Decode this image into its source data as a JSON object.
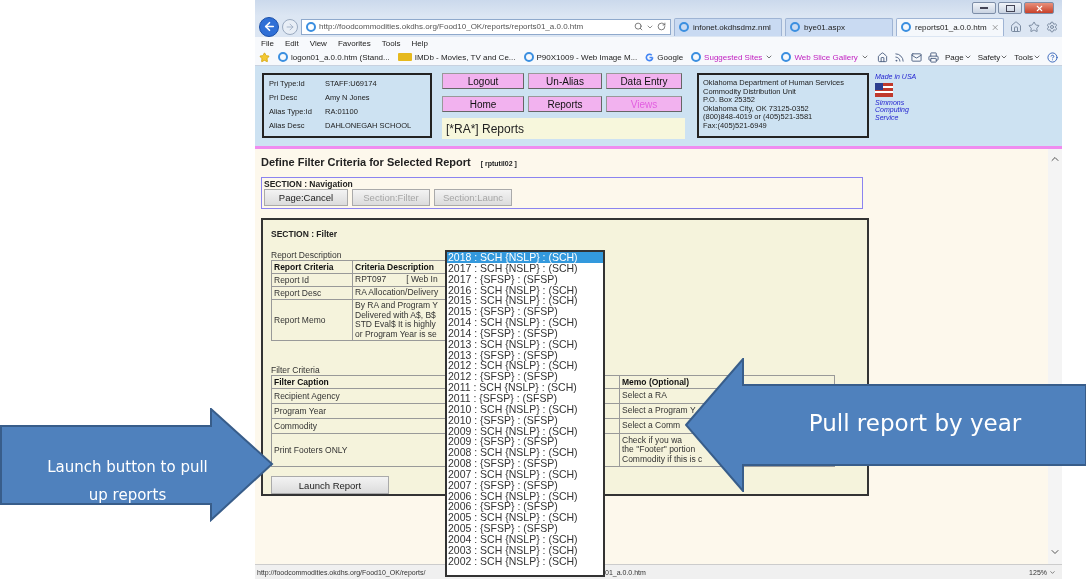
{
  "browser": {
    "address": "http://foodcommodities.okdhs.org/Food10_OK/reports/reports01_a.0.0.htm",
    "tabs": [
      {
        "label": "infonet.okdhsdmz.nml",
        "selected": false
      },
      {
        "label": "bye01.aspx",
        "selected": false
      },
      {
        "label": "reports01_a.0.0.htm",
        "selected": true
      }
    ],
    "menu": [
      "File",
      "Edit",
      "View",
      "Favorites",
      "Tools",
      "Help"
    ],
    "favorites": [
      {
        "label": "logon01_a.0.0.htm (Stand...",
        "kind": "page"
      },
      {
        "label": "IMDb - Movies, TV and Ce...",
        "kind": "imdb"
      },
      {
        "label": "P90X1009 - Web Image M...",
        "kind": "page"
      },
      {
        "label": "Google",
        "kind": "google"
      },
      {
        "label": "Suggested Sites",
        "kind": "menu"
      },
      {
        "label": "Web Slice Gallery",
        "kind": "menu"
      }
    ],
    "commands": [
      "Page",
      "Safety",
      "Tools"
    ]
  },
  "user_info": [
    {
      "label": "Pri Type:Id",
      "value": "STAFF:U69174"
    },
    {
      "label": "Pri Desc",
      "value": "Amy N Jones"
    },
    {
      "label": "Alias Type:Id",
      "value": "RA:01100"
    },
    {
      "label": "Alias Desc",
      "value": "DAHLONEGAH SCHOOL"
    }
  ],
  "nav_buttons": [
    {
      "label": "Logout",
      "disabled": false
    },
    {
      "label": "Un-Alias",
      "disabled": false
    },
    {
      "label": "Data Entry",
      "disabled": false
    },
    {
      "label": "Home",
      "disabled": false
    },
    {
      "label": "Reports",
      "disabled": false
    },
    {
      "label": "Views",
      "disabled": true
    }
  ],
  "context_title": "[*RA*] Reports",
  "address_lines": [
    "Oklahoma Department of Human Services",
    "Commodity Distribution Unit",
    "P.O. Box 25352",
    "Oklahoma City, OK 73125-0352",
    "(800)848-4019 or (405)521-3581",
    "Fax:(405)521-6949"
  ],
  "badge": {
    "made_in": "Made in USA",
    "vendor": "Simmons Computing Service"
  },
  "page": {
    "title": "Define Filter Criteria for Selected Report",
    "code": "[ rptutil02 ]"
  },
  "navigation_section": {
    "title": "SECTION : Navigation",
    "buttons": [
      {
        "label": "Page:Cancel",
        "disabled": false
      },
      {
        "label": "Section:Filter",
        "disabled": true
      },
      {
        "label": "Section:Launc",
        "disabled": true
      }
    ]
  },
  "filter_section": {
    "title": "SECTION : Filter",
    "description_caption": "Report Description",
    "description_columns": [
      "Report Criteria",
      "Criteria Description"
    ],
    "description_rows": [
      {
        "criteria": "Report Id",
        "lines": [
          "RPT097"
        ],
        "note": "[ Web In"
      },
      {
        "criteria": "Report Desc",
        "lines": [
          "RA Allocation/Delivery"
        ]
      },
      {
        "criteria": "Report Memo",
        "lines": [
          "By RA and Program Y",
          "Delivered with A$, B$",
          "STD Eval$ It is highly",
          "or Program Year is se"
        ]
      }
    ],
    "filter_caption": "Filter Criteria",
    "filter_columns": [
      "Filter Caption",
      "Memo (Optional)"
    ],
    "filter_rows": [
      {
        "caption": "Recipient Agency",
        "memo": [
          "Select a RA"
        ]
      },
      {
        "caption": "Program Year",
        "memo": [
          "Select a Program Y"
        ]
      },
      {
        "caption": "Commodity",
        "memo": [
          "Select a Comm"
        ]
      },
      {
        "caption": "Print Footers ONLY",
        "memo": [
          "Check if you wa",
          "the \"Footer\" portion",
          "Commodity if this is c"
        ]
      }
    ],
    "launch_button": "Launch Report"
  },
  "year_dropdown": {
    "options": [
      {
        "label": "2018 : SCH {NSLP} : (SCH)",
        "selected": true
      },
      {
        "label": "2017 : SCH {NSLP} : (SCH)",
        "selected": false
      },
      {
        "label": "2017 : {SFSP} : (SFSP)",
        "selected": false
      },
      {
        "label": "2016 : SCH {NSLP} : (SCH)",
        "selected": false
      },
      {
        "label": "2015 : SCH {NSLP} : (SCH)",
        "selected": false
      },
      {
        "label": "2015 : {SFSP} : (SFSP)",
        "selected": false
      },
      {
        "label": "2014 : SCH {NSLP} : (SCH)",
        "selected": false
      },
      {
        "label": "2014 : {SFSP} : (SFSP)",
        "selected": false
      },
      {
        "label": "2013 : SCH {NSLP} : (SCH)",
        "selected": false
      },
      {
        "label": "2013 : {SFSP} : (SFSP)",
        "selected": false
      },
      {
        "label": "2012 : SCH {NSLP} : (SCH)",
        "selected": false
      },
      {
        "label": "2012 : {SFSP} : (SFSP)",
        "selected": false
      },
      {
        "label": "2011 : SCH {NSLP} : (SCH)",
        "selected": false
      },
      {
        "label": "2011 : {SFSP} : (SFSP)",
        "selected": false
      },
      {
        "label": "2010 : SCH {NSLP} : (SCH)",
        "selected": false
      },
      {
        "label": "2010 : {SFSP} : (SFSP)",
        "selected": false
      },
      {
        "label": "2009 : SCH {NSLP} : (SCH)",
        "selected": false
      },
      {
        "label": "2009 : {SFSP} : (SFSP)",
        "selected": false
      },
      {
        "label": "2008 : SCH {NSLP} : (SCH)",
        "selected": false
      },
      {
        "label": "2008 : {SFSP} : (SFSP)",
        "selected": false
      },
      {
        "label": "2007 : SCH {NSLP} : (SCH)",
        "selected": false
      },
      {
        "label": "2007 : {SFSP} : (SFSP)",
        "selected": false
      },
      {
        "label": "2006 : SCH {NSLP} : (SCH)",
        "selected": false
      },
      {
        "label": "2006 : {SFSP} : (SFSP)",
        "selected": false
      },
      {
        "label": "2005 : SCH {NSLP} : (SCH)",
        "selected": false
      },
      {
        "label": "2005 : {SFSP} : (SFSP)",
        "selected": false
      },
      {
        "label": "2004 : SCH {NSLP} : (SCH)",
        "selected": false
      },
      {
        "label": "2003 : SCH {NSLP} : (SCH)",
        "selected": false
      },
      {
        "label": "2002 : SCH {NSLP} : (SCH)",
        "selected": false
      }
    ]
  },
  "status_bar": {
    "url_start": "http://foodcommodities.okdhs.org/Food10_OK/reports/",
    "url_end": "01_a.0.0.htm",
    "zoom": "125%"
  },
  "callouts": [
    {
      "text": "Launch button to pull up reports",
      "kind": "right"
    },
    {
      "text": "Pull report by year",
      "kind": "left"
    }
  ]
}
